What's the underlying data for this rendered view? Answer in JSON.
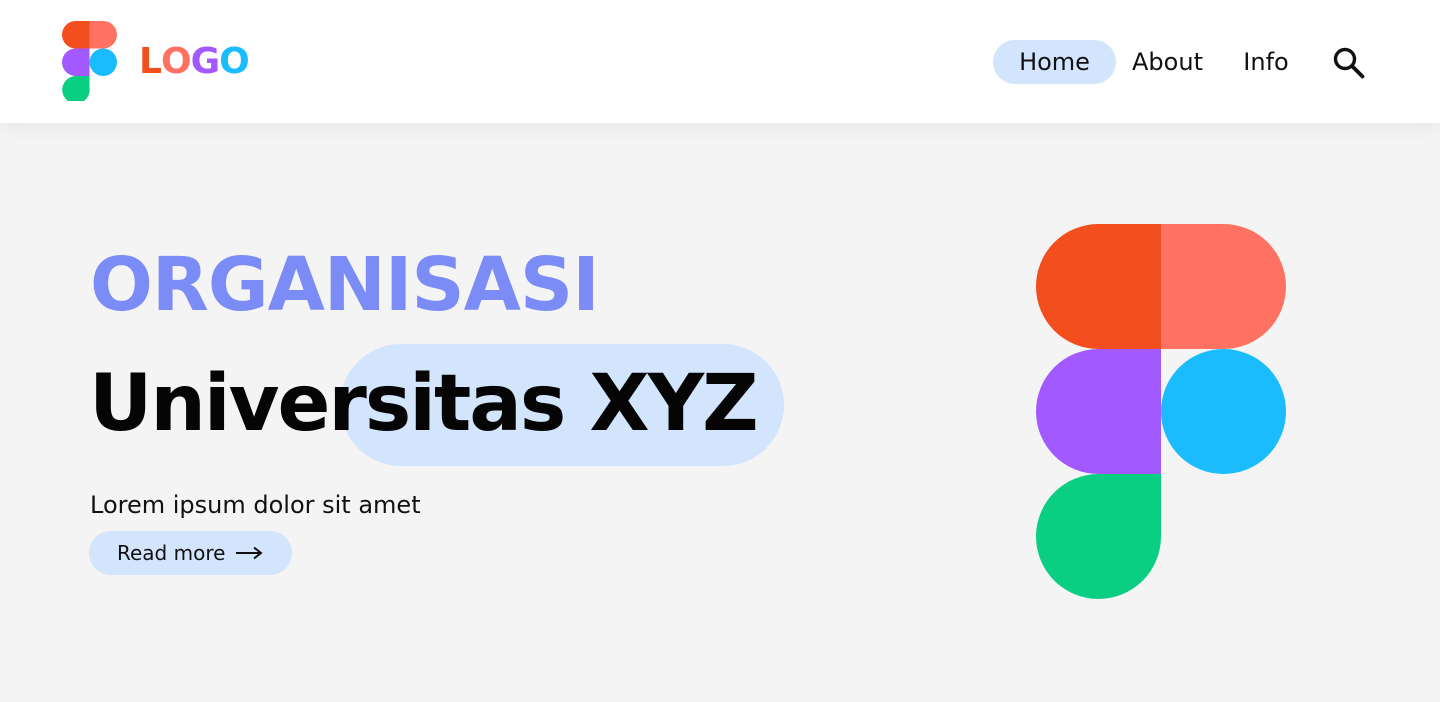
{
  "header": {
    "logo_text_letters": [
      "L",
      "O",
      "G",
      "O"
    ],
    "logo_text_colors": [
      "#f24e1e",
      "#ff7262",
      "#a259ff",
      "#1abcfe"
    ],
    "nav": [
      {
        "label": "Home",
        "active": true
      },
      {
        "label": "About",
        "active": false
      },
      {
        "label": "Info",
        "active": false
      }
    ],
    "search_icon": "search-icon"
  },
  "hero": {
    "kicker": "ORGANISASI",
    "title": "Universitas XYZ",
    "subtitle": "Lorem ipsum dolor sit amet",
    "cta_label": "Read more",
    "cta_icon": "arrow-right-icon"
  },
  "colors": {
    "accent_pill": "#d3e4fd",
    "kicker": "#7b8cf6",
    "figma_red": "#f24e1e",
    "figma_coral": "#ff7262",
    "figma_purple": "#a259ff",
    "figma_blue": "#1abcfe",
    "figma_green": "#0acf83"
  }
}
